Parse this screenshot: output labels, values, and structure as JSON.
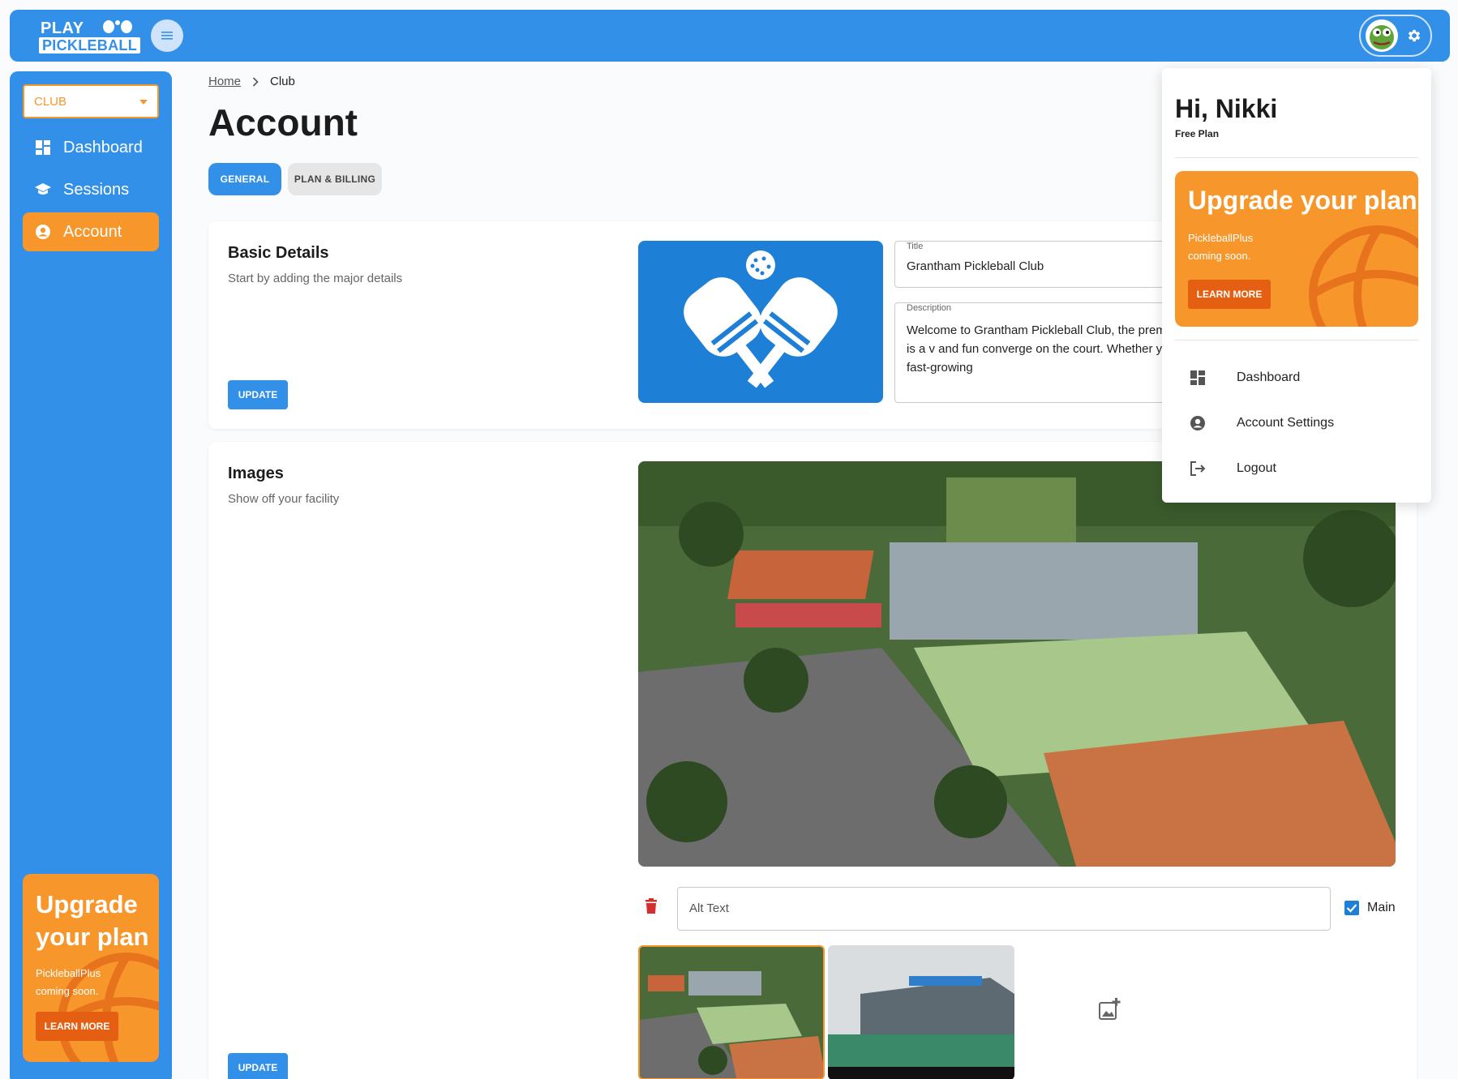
{
  "brand": {
    "line1": "PLAY",
    "line2": "PICKLEBALL"
  },
  "sidebar": {
    "club_select": "CLUB",
    "items": [
      {
        "label": "Dashboard",
        "icon": "dashboard-icon"
      },
      {
        "label": "Sessions",
        "icon": "school-icon"
      },
      {
        "label": "Account",
        "icon": "account-circle-icon",
        "active": true
      }
    ],
    "promo": {
      "title": "Upgrade your plan",
      "subtitle": "PickleballPlus coming soon.",
      "button": "LEARN MORE"
    }
  },
  "breadcrumb": {
    "home": "Home",
    "current": "Club"
  },
  "page": {
    "title": "Account",
    "tabs": [
      {
        "label": "GENERAL",
        "active": true
      },
      {
        "label": "PLAN & BILLING",
        "active": false
      }
    ]
  },
  "basic_details": {
    "heading": "Basic Details",
    "description": "Start by adding the major details",
    "update_button": "UPDATE",
    "title_field": {
      "label": "Title",
      "value": "Grantham Pickleball Club"
    },
    "description_field": {
      "label": "Description",
      "value": "Welcome to Grantham Pickleball Club, the premier des levels. Nestled in the heart of Grantham, our club is a v and fun converge on the court. Whether you're a seaso newcomer eager to learn the ropes of this fast-growing"
    }
  },
  "images": {
    "heading": "Images",
    "description": "Show off your facility",
    "alt_text_placeholder": "Alt Text",
    "main_label": "Main",
    "main_checked": true,
    "update_button": "UPDATE"
  },
  "user_menu": {
    "greeting": "Hi, Nikki",
    "plan": "Free Plan",
    "promo": {
      "title": "Upgrade your plan",
      "subtitle": "PickleballPlus coming soon.",
      "button": "LEARN MORE"
    },
    "items": [
      {
        "label": "Dashboard",
        "icon": "dashboard-icon"
      },
      {
        "label": "Account Settings",
        "icon": "account-circle-icon"
      },
      {
        "label": "Logout",
        "icon": "logout-icon"
      }
    ]
  },
  "colors": {
    "primary": "#3390e8",
    "accent": "#f7972b",
    "accent_dark": "#e45f12",
    "danger": "#d32f2f"
  }
}
